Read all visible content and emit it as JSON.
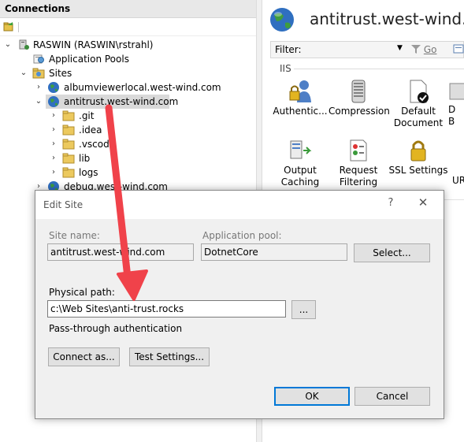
{
  "connections": {
    "header": "Connections",
    "tree": {
      "server": "RASWIN (RASWIN\\rstrahl)",
      "app_pools": "Application Pools",
      "sites": "Sites",
      "site_items": [
        "albumviewerlocal.west-wind.com",
        "antitrust.west-wind.com",
        "debug.west-wind.com"
      ],
      "folders": [
        ".git",
        ".idea",
        ".vscode",
        "lib",
        "logs"
      ]
    }
  },
  "right_pane": {
    "site_title": "antitrust.west-wind.com",
    "filter_label": "Filter:",
    "filter_value": "",
    "go_label": "Go",
    "group_label": "IIS",
    "features": [
      {
        "label": "Authentic...",
        "icon": "authentication-icon"
      },
      {
        "label": "Compression",
        "icon": "compression-icon"
      },
      {
        "label": "Default Document",
        "icon": "default-document-icon"
      },
      {
        "label": "D B",
        "icon": "directory-browsing-icon"
      },
      {
        "label": "Output Caching",
        "icon": "output-caching-icon"
      },
      {
        "label": "Request Filtering",
        "icon": "request-filtering-icon"
      },
      {
        "label": "SSL Settings",
        "icon": "ssl-settings-icon"
      },
      {
        "label": "UR",
        "icon": "url-rewrite-icon"
      }
    ]
  },
  "dialog": {
    "title": "Edit Site",
    "help_glyph": "?",
    "close_glyph": "✕",
    "site_name_label": "Site name:",
    "site_name_value": "antitrust.west-wind.com",
    "app_pool_label": "Application pool:",
    "app_pool_value": "DotnetCore",
    "select_button": "Select...",
    "physical_path_label": "Physical path:",
    "physical_path_value": "c:\\Web Sites\\anti-trust.rocks",
    "browse_button": "...",
    "pass_through": "Pass-through authentication",
    "connect_as_button": "Connect as...",
    "test_settings_button": "Test Settings...",
    "ok_button": "OK",
    "cancel_button": "Cancel"
  },
  "colors": {
    "annotation_arrow": "#f0424a",
    "selection": "#d9d9d9",
    "default_button_border": "#0078d7"
  }
}
